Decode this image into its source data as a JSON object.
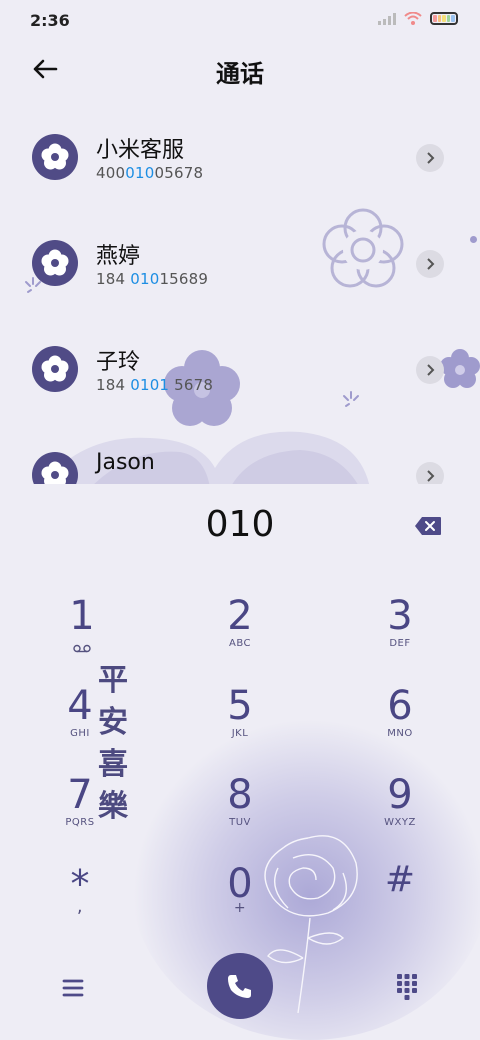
{
  "status_bar": {
    "time": "2:36"
  },
  "header": {
    "title": "通话"
  },
  "contacts": [
    {
      "name": "小米客服",
      "num_pre": "400",
      "num_hl": "010",
      "num_post": "05678"
    },
    {
      "name": "燕婷",
      "num_pre": "184 ",
      "num_hl": "010",
      "num_post": "15689"
    },
    {
      "name": "子玲",
      "num_pre": "184 ",
      "num_hl": "0101",
      "num_post": " 5678"
    },
    {
      "name": "Jason",
      "num_pre": "",
      "num_hl": "",
      "num_post": ""
    }
  ],
  "dialer": {
    "input": "010",
    "keys": [
      {
        "digit": "1",
        "letters": "ꝏ"
      },
      {
        "digit": "2",
        "letters": "ABC"
      },
      {
        "digit": "3",
        "letters": "DEF"
      },
      {
        "digit": "4",
        "letters": "GHI"
      },
      {
        "digit": "5",
        "letters": "JKL"
      },
      {
        "digit": "6",
        "letters": "MNO"
      },
      {
        "digit": "7",
        "letters": "PQRS"
      },
      {
        "digit": "8",
        "letters": "TUV"
      },
      {
        "digit": "9",
        "letters": "WXYZ"
      },
      {
        "digit": "*",
        "letters": ","
      },
      {
        "digit": "0",
        "letters": "+"
      },
      {
        "digit": "#",
        "letters": ""
      }
    ]
  },
  "decoration": {
    "calligraphy": "平安喜樂"
  },
  "colors": {
    "accent": "#4e4a88",
    "highlight": "#1d8ee3",
    "background": "#eeedf5"
  }
}
